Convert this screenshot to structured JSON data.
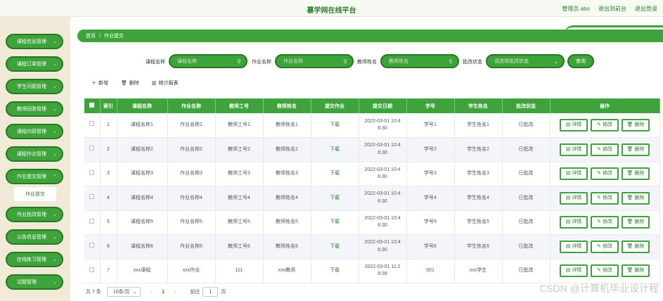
{
  "header": {
    "title": "慕学网在线平台",
    "user": "管理员 abo",
    "back_front": "退出到前台",
    "logout": "退出登录"
  },
  "sidebar": {
    "items": [
      {
        "label": "课程信息管理"
      },
      {
        "label": "课程订单管理"
      },
      {
        "label": "学生问题管理"
      },
      {
        "label": "教师回答管理"
      },
      {
        "label": "课程内容管理"
      },
      {
        "label": "课程作业管理"
      },
      {
        "label": "作业提交管理"
      },
      {
        "label": "作业批改管理"
      },
      {
        "label": "公告信息管理"
      },
      {
        "label": "在线练习管理"
      },
      {
        "label": "试题管理"
      }
    ],
    "submenu_label": "作业提交"
  },
  "breadcrumb": {
    "home": "首页",
    "sep": "/",
    "current": "作业提交"
  },
  "search": {
    "course_label": "课程名称",
    "course_placeholder": "课程名称",
    "homework_label": "作业名称",
    "homework_placeholder": "作业名称",
    "teacher_label": "教师姓名",
    "teacher_placeholder": "教师姓名",
    "status_label": "批改状态",
    "status_placeholder": "请选择批改状态",
    "query": "查询"
  },
  "actions": {
    "add": "新增",
    "delete": "删除",
    "report": "统计报表"
  },
  "table": {
    "headers": [
      "索引",
      "课程名称",
      "作业名称",
      "教师工号",
      "教师姓名",
      "提交作业",
      "提交日期",
      "学号",
      "学生姓名",
      "批改状态",
      "操作"
    ],
    "rows": [
      [
        "1",
        "课程名称1",
        "作业名称1",
        "教师工号1",
        "教师姓名1",
        "下载",
        "2022-03-01 10:4",
        "6:30",
        "学号1",
        "学生姓名1",
        "已批改"
      ],
      [
        "2",
        "课程名称2",
        "作业名称2",
        "教师工号2",
        "教师姓名2",
        "下载",
        "2022-03-01 10:4",
        "6:30",
        "学号2",
        "学生姓名2",
        "已批改"
      ],
      [
        "3",
        "课程名称3",
        "作业名称3",
        "教师工号3",
        "教师姓名3",
        "下载",
        "2022-03-01 10:4",
        "6:30",
        "学号3",
        "学生姓名3",
        "已批改"
      ],
      [
        "4",
        "课程名称4",
        "作业名称4",
        "教师工号4",
        "教师姓名4",
        "下载",
        "2022-03-01 10:4",
        "6:30",
        "学号4",
        "学生姓名4",
        "已批改"
      ],
      [
        "5",
        "课程名称5",
        "作业名称5",
        "教师工号5",
        "教师姓名5",
        "下载",
        "2022-03-01 10:4",
        "6:30",
        "学号5",
        "学生姓名5",
        "已批改"
      ],
      [
        "6",
        "课程名称6",
        "作业名称6",
        "教师工号6",
        "教师姓名6",
        "下载",
        "2022-03-01 10:4",
        "6:30",
        "学号6",
        "学生姓名6",
        "已批改"
      ],
      [
        "7",
        "xxx课程",
        "xxx作业",
        "111",
        "xxx教师",
        "下载",
        "2022-03-01 11:2",
        "8:39",
        "001",
        "xxx学生",
        "已批改"
      ]
    ],
    "ops": {
      "detail": "详情",
      "edit": "修改",
      "delete": "删除"
    }
  },
  "pager": {
    "total": "共 7 条",
    "size": "10条/页",
    "prev": "‹",
    "page": "1",
    "next": "›",
    "goto": "前往",
    "goto_value": "1",
    "unit": "页"
  },
  "watermark": "CSDN @计算机毕业设计程",
  "colors": {
    "primary": "#3ea33b",
    "border": "#237a21",
    "sidebar_bg": "#f2ead8"
  }
}
